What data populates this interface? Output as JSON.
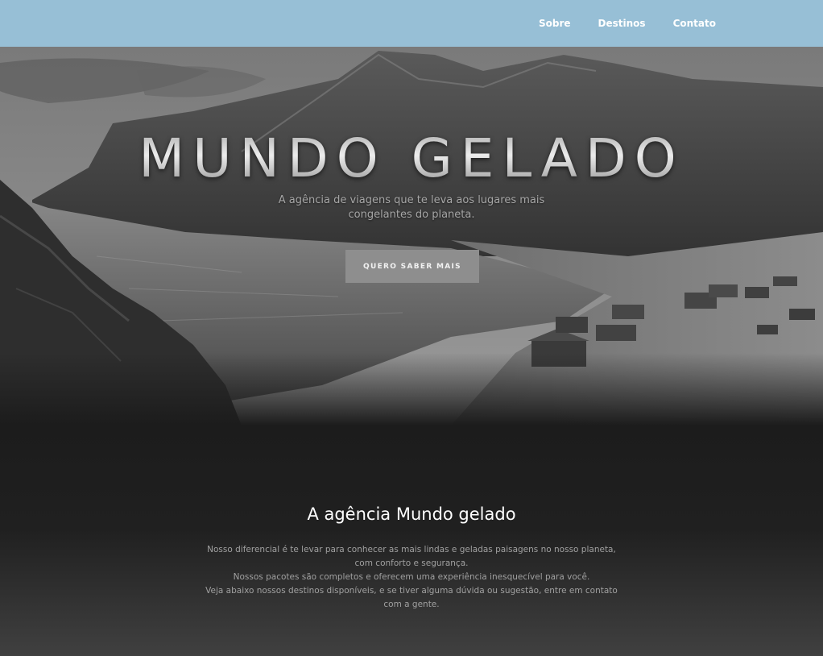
{
  "nav": {
    "items": [
      {
        "label": "Sobre"
      },
      {
        "label": "Destinos"
      },
      {
        "label": "Contato"
      }
    ]
  },
  "hero": {
    "title": "MUNDO GELADO",
    "subtitle": "A agência de viagens que te leva aos lugares mais congelantes do planeta.",
    "button_label": "QUERO SABER MAIS"
  },
  "about": {
    "title": "A agência Mundo gelado",
    "paragraphs": [
      "Nosso diferencial é te levar para conhecer as mais lindas e geladas paisagens no nosso planeta, com conforto e segurança.",
      "Nossos pacotes são completos e oferecem uma experiência inesquecível para você.",
      "Veja abaixo nossos destinos disponíveis, e se tiver alguma dúvida ou sugestão, entre em contato com a gente."
    ]
  },
  "colors": {
    "navbar": "#97bfd6",
    "button": "#8e8e8e",
    "section_bg": "#1c1c1c"
  }
}
